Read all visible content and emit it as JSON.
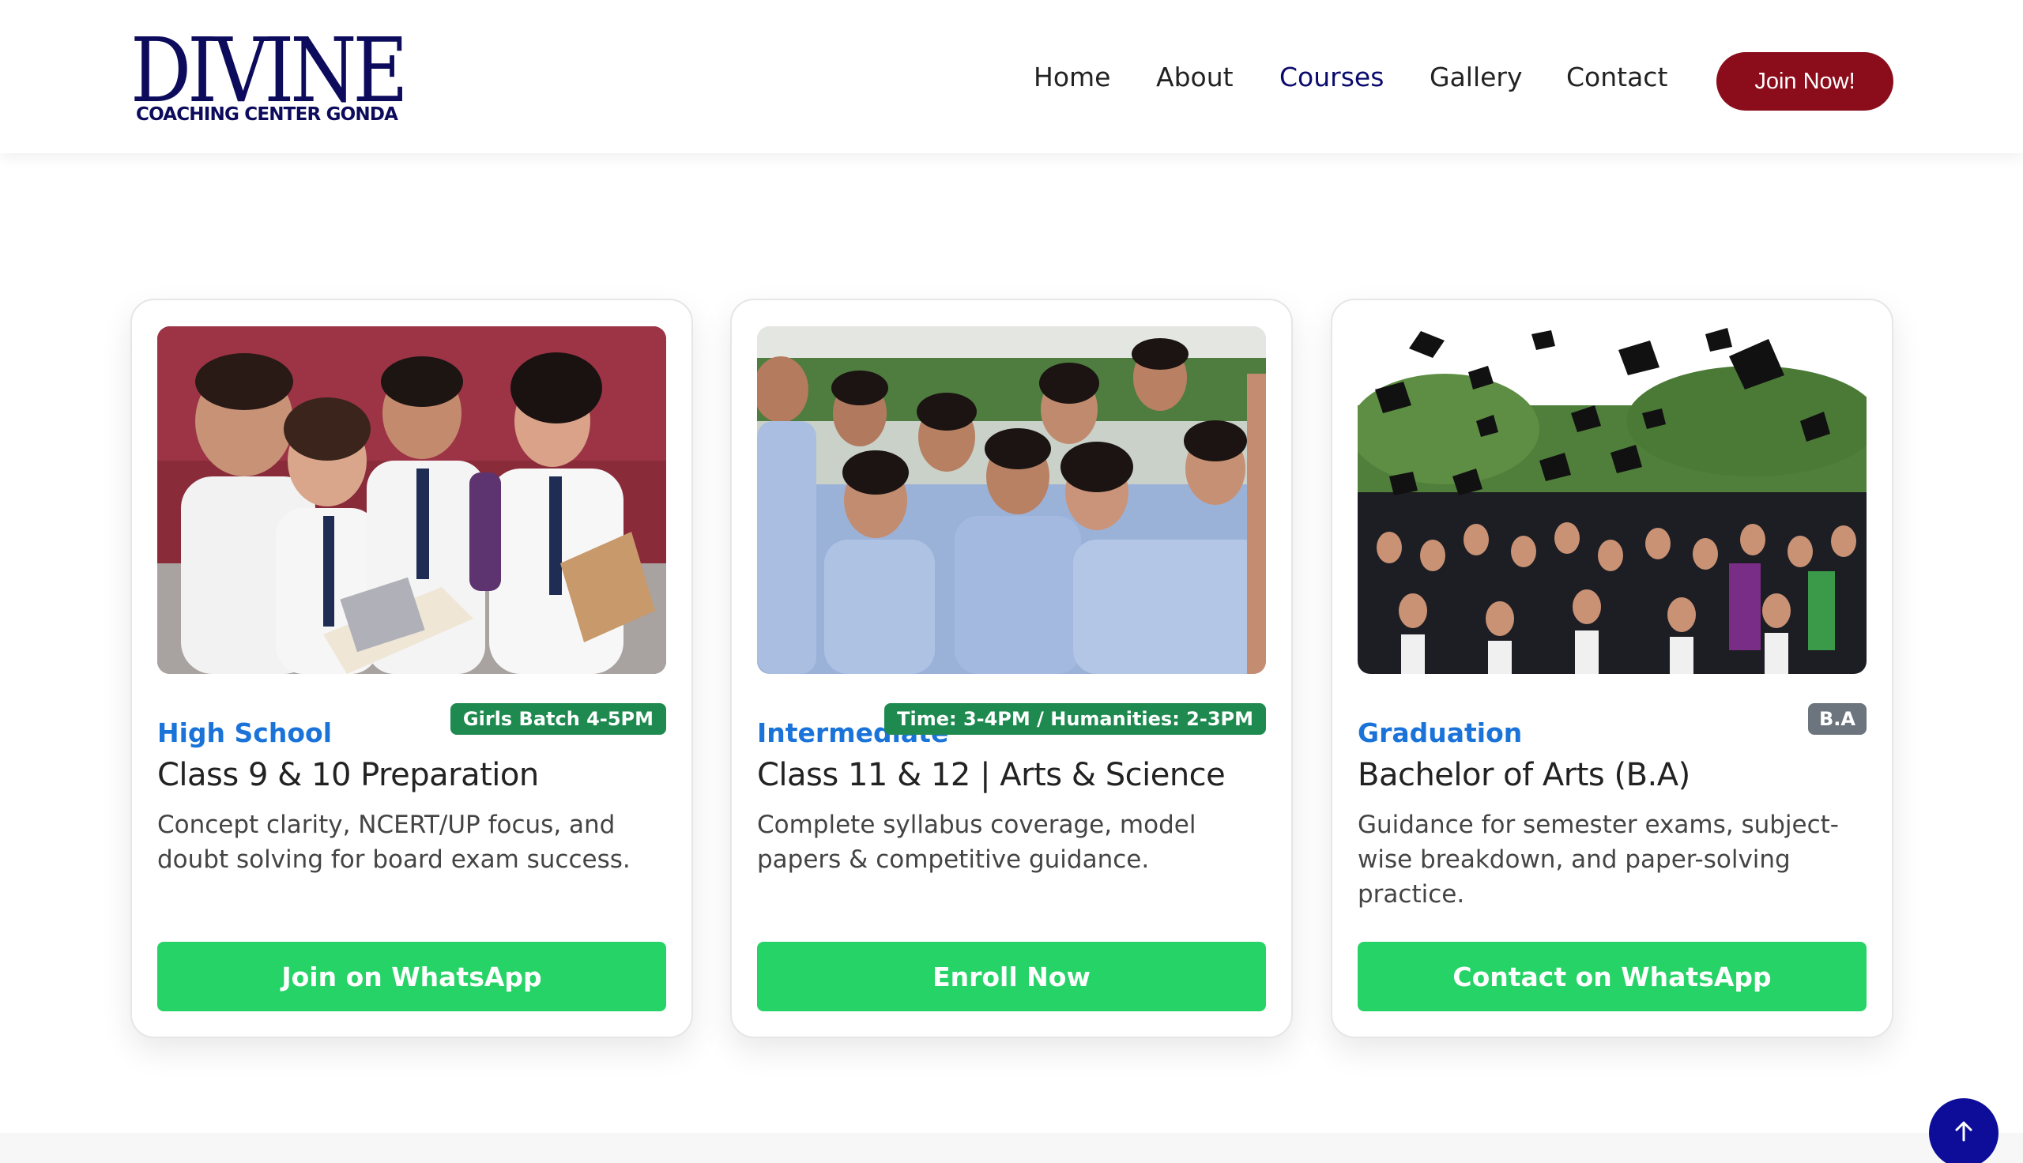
{
  "brand": {
    "name": "DIVINE",
    "subtitle": "COACHING CENTER GONDA",
    "color": "#0d0b5c"
  },
  "nav": {
    "items": [
      {
        "label": "Home",
        "active": false
      },
      {
        "label": "About",
        "active": false
      },
      {
        "label": "Courses",
        "active": true
      },
      {
        "label": "Gallery",
        "active": false
      },
      {
        "label": "Contact",
        "active": false
      }
    ],
    "join_label": "Join Now!",
    "join_color": "#8b0d1b"
  },
  "courses": [
    {
      "image": "high-school-students-photo",
      "category": "High School",
      "badge": "Girls Batch 4-5PM",
      "title": "Class 9 & 10 Preparation",
      "description": "Concept clarity, NCERT/UP focus, and doubt solving for board exam success.",
      "button": "Join on WhatsApp"
    },
    {
      "image": "intermediate-students-photo",
      "category": "Intermediate",
      "badge": "Time: 3-4PM / Humanities: 2-3PM",
      "title": "Class 11 & 12 | Arts & Science",
      "description": "Complete syllabus coverage, model papers & competitive guidance.",
      "button": "Enroll Now"
    },
    {
      "image": "graduation-caps-photo",
      "category": "Graduation",
      "badge": "B.A",
      "title": "Bachelor of Arts (B.A)",
      "description": "Guidance for semester exams, subject-wise breakdown, and paper-solving practice.",
      "button": "Contact on WhatsApp"
    }
  ],
  "colors": {
    "category": "#1a73d9",
    "badge_green": "#1f8a50",
    "badge_gray": "#6c757d",
    "whatsapp": "#25d366",
    "scroll_top": "#0d0d9a"
  },
  "scroll_top_icon": "arrow-up-icon"
}
